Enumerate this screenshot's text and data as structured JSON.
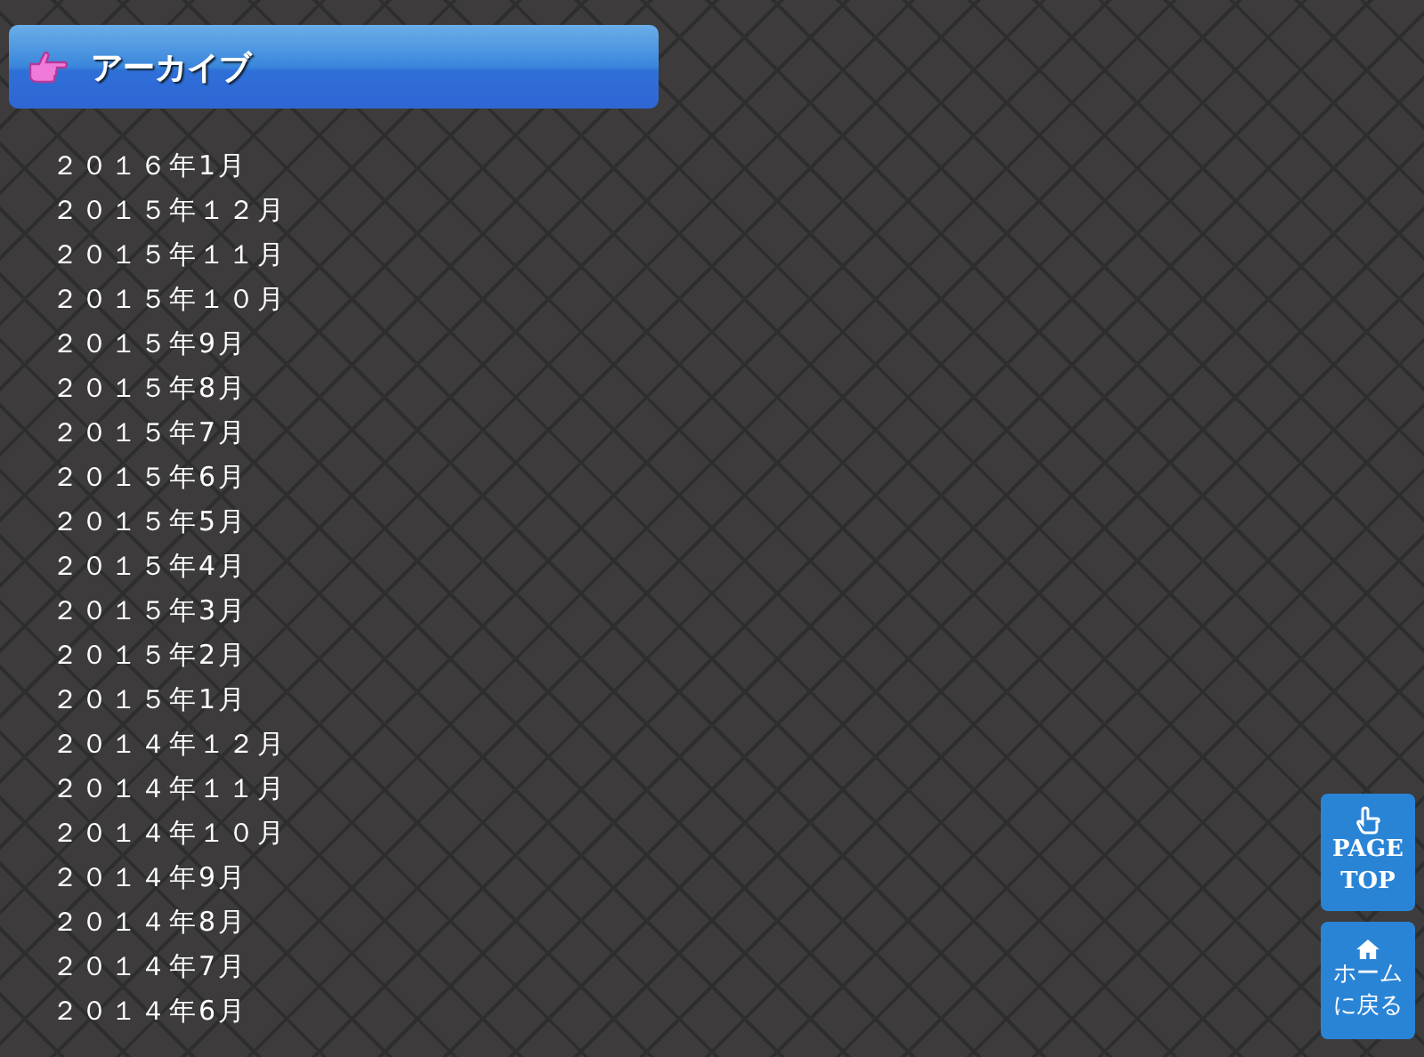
{
  "archive": {
    "title": "アーカイブ",
    "items": [
      "２０１６年1月",
      "２０１５年１２月",
      "２０１５年１１月",
      "２０１５年１０月",
      "２０１５年9月",
      "２０１５年8月",
      "２０１５年7月",
      "２０１５年6月",
      "２０１５年5月",
      "２０１５年4月",
      "２０１５年3月",
      "２０１５年2月",
      "２０１５年1月",
      "２０１４年１２月",
      "２０１４年１１月",
      "２０１４年１０月",
      "２０１４年9月",
      "２０１４年8月",
      "２０１４年7月",
      "２０１４年6月"
    ]
  },
  "floating_buttons": [
    {
      "kind": "top",
      "lines": [
        "PAGE",
        "TOP"
      ]
    },
    {
      "kind": "home",
      "lines": [
        "ホーム",
        "に戻る"
      ]
    }
  ]
}
